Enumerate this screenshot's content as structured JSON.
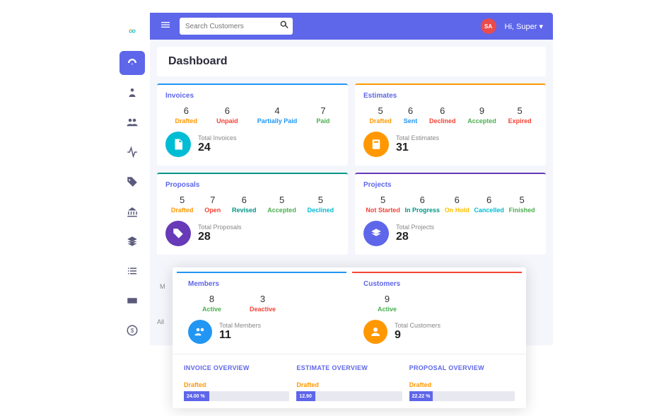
{
  "topbar": {
    "search_placeholder": "Search Customers",
    "avatar_initials": "SA",
    "username": "Hi, Super"
  },
  "page_title": "Dashboard",
  "invoices": {
    "title": "Invoices",
    "stats": [
      {
        "val": "6",
        "lbl": "Drafted",
        "color": "c-orange"
      },
      {
        "val": "6",
        "lbl": "Unpaid",
        "color": "c-red"
      },
      {
        "val": "4",
        "lbl": "Partially Paid",
        "color": "c-blue"
      },
      {
        "val": "7",
        "lbl": "Paid",
        "color": "c-green"
      }
    ],
    "total_label": "Total Invoices",
    "total_val": "24"
  },
  "estimates": {
    "title": "Estimates",
    "stats": [
      {
        "val": "5",
        "lbl": "Drafted",
        "color": "c-orange"
      },
      {
        "val": "6",
        "lbl": "Sent",
        "color": "c-blue"
      },
      {
        "val": "6",
        "lbl": "Declined",
        "color": "c-red"
      },
      {
        "val": "9",
        "lbl": "Accepted",
        "color": "c-green"
      },
      {
        "val": "5",
        "lbl": "Expired",
        "color": "c-red"
      }
    ],
    "total_label": "Total Estimates",
    "total_val": "31"
  },
  "proposals": {
    "title": "Proposals",
    "stats": [
      {
        "val": "5",
        "lbl": "Drafted",
        "color": "c-orange"
      },
      {
        "val": "7",
        "lbl": "Open",
        "color": "c-red"
      },
      {
        "val": "6",
        "lbl": "Revised",
        "color": "c-teal"
      },
      {
        "val": "5",
        "lbl": "Accepted",
        "color": "c-green"
      },
      {
        "val": "5",
        "lbl": "Declined",
        "color": "c-cyan"
      }
    ],
    "total_label": "Total Proposals",
    "total_val": "28"
  },
  "projects": {
    "title": "Projects",
    "stats": [
      {
        "val": "5",
        "lbl": "Not Started",
        "color": "c-red"
      },
      {
        "val": "6",
        "lbl": "In Progress",
        "color": "c-teal"
      },
      {
        "val": "6",
        "lbl": "On Hold",
        "color": "c-gold"
      },
      {
        "val": "6",
        "lbl": "Cancelled",
        "color": "c-cyan"
      },
      {
        "val": "5",
        "lbl": "Finished",
        "color": "c-green"
      }
    ],
    "total_label": "Total Projects",
    "total_val": "28"
  },
  "members": {
    "title": "Members",
    "active_val": "8",
    "active_lbl": "Active",
    "deactive_val": "3",
    "deactive_lbl": "Deactive",
    "total_label": "Total Members",
    "total_val": "11"
  },
  "customers": {
    "title": "Customers",
    "active_val": "9",
    "active_lbl": "Active",
    "total_label": "Total Customers",
    "total_val": "9"
  },
  "overviews": {
    "invoice": {
      "title": "INVOICE OVERVIEW",
      "label": "Drafted",
      "pct": "24.00 %",
      "width": "24%"
    },
    "estimate": {
      "title": "ESTIMATE OVERVIEW",
      "label": "Drafted",
      "pct": "12.90",
      "width": "13%"
    },
    "proposal": {
      "title": "PROPOSAL OVERVIEW",
      "label": "Drafted",
      "pct": "22.22 %",
      "width": "22%"
    }
  },
  "tabs_peek": {
    "m": "M",
    "all": "All"
  }
}
